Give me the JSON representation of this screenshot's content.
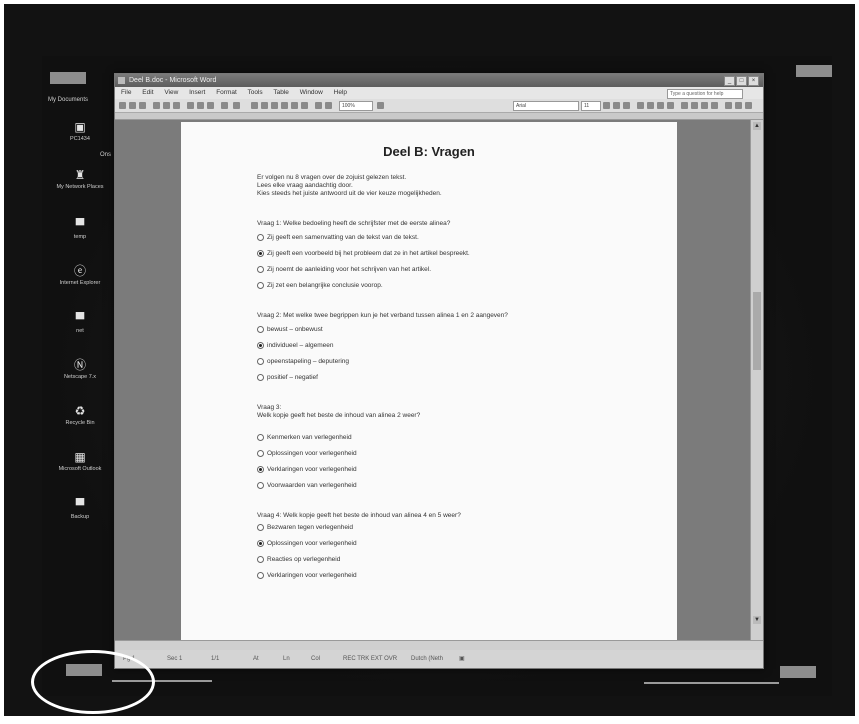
{
  "desktop": {
    "top_label": "My Documents",
    "side_label": "Ons",
    "icons": [
      {
        "name": "computer-icon",
        "glyph": "▣",
        "label": "PC1434"
      },
      {
        "name": "network-icon",
        "glyph": "♜",
        "label": "My Network Places"
      },
      {
        "name": "folder-icon",
        "glyph": "▀",
        "label": "temp"
      },
      {
        "name": "ie-icon",
        "glyph": "ⓔ",
        "label": "Internet Explorer"
      },
      {
        "name": "folder-icon",
        "glyph": "▀",
        "label": "net"
      },
      {
        "name": "netscape-icon",
        "glyph": "Ⓝ",
        "label": "Netscape 7.x"
      },
      {
        "name": "recycle-bin-icon",
        "glyph": "♻",
        "label": "Recycle Bin"
      },
      {
        "name": "outlook-icon",
        "glyph": "▦",
        "label": "Microsoft Outlook"
      },
      {
        "name": "folder-icon",
        "glyph": "▀",
        "label": "Backup"
      }
    ]
  },
  "window": {
    "title": "Deel B.doc - Microsoft Word",
    "controls": [
      "_",
      "□",
      "×"
    ],
    "menu": [
      "File",
      "Edit",
      "View",
      "Insert",
      "Format",
      "Tools",
      "Table",
      "Window",
      "Help"
    ],
    "ask_placeholder": "Type a question for help",
    "zoom": "100%",
    "font": "Arial",
    "font_size": "11"
  },
  "document": {
    "title": "Deel B: Vragen",
    "intro": [
      "Er volgen nu 8 vragen over de zojuist gelezen tekst.",
      "Lees elke vraag aandachtig door.",
      "Kies steeds het juiste antwoord uit de vier keuze mogelijkheden."
    ],
    "questions": [
      {
        "lines": [
          "Vraag 1: Welke bedoeling heeft de schrijfster met de eerste alinea?"
        ],
        "options": [
          {
            "text": "Zij geeft een samenvatting van de tekst van de tekst.",
            "selected": false
          },
          {
            "text": "Zij geeft een voorbeeld bij het probleem dat ze in het artikel bespreekt.",
            "selected": true
          },
          {
            "text": "Zij noemt de aanleiding voor het schrijven van het artikel.",
            "selected": false
          },
          {
            "text": "Zij zet een belangrijke conclusie voorop.",
            "selected": false
          }
        ]
      },
      {
        "lines": [
          "Vraag 2: Met welke twee begrippen kun je het verband tussen alinea 1 en 2 aangeven?"
        ],
        "options": [
          {
            "text": "bewust – onbewust",
            "selected": false
          },
          {
            "text": "individueel – algemeen",
            "selected": true
          },
          {
            "text": "opeenstapeling – deputering",
            "selected": false
          },
          {
            "text": "positief – negatief",
            "selected": false
          }
        ]
      },
      {
        "lines": [
          "Vraag 3:",
          "Welk kopje geeft het beste de inhoud van alinea 2 weer?"
        ],
        "options": [
          {
            "text": "Kenmerken van verlegenheid",
            "selected": false
          },
          {
            "text": "Oplossingen voor verlegenheid",
            "selected": false
          },
          {
            "text": "Verklaringen voor verlegenheid",
            "selected": true
          },
          {
            "text": "Voorwaarden van verlegenheid",
            "selected": false
          }
        ]
      },
      {
        "lines": [
          "Vraag 4: Welk kopje geeft het beste de inhoud van alinea 4 en 5 weer?"
        ],
        "options": [
          {
            "text": "Bezwaren tegen verlegenheid",
            "selected": false
          },
          {
            "text": "Oplossingen voor verlegenheid",
            "selected": true
          },
          {
            "text": "Reacties op verlegenheid",
            "selected": false
          },
          {
            "text": "Verklaringen voor verlegenheid",
            "selected": false
          }
        ]
      }
    ]
  },
  "statusbar": {
    "page": "Pg 1",
    "sec": "Sec 1",
    "pos": "1/1",
    "at": "At",
    "ln": "Ln",
    "col": "Col",
    "modes": "REC  TRK  EXT  OVR",
    "lang": "Dutch (Neth"
  }
}
